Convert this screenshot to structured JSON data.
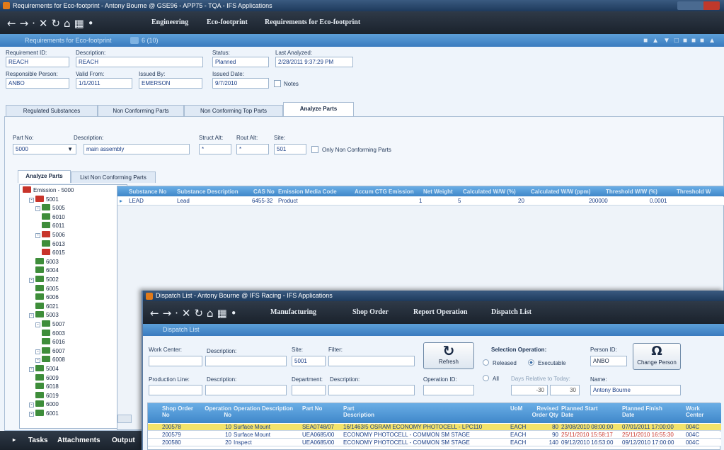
{
  "main": {
    "title": "Requirements for Eco-footprint - Antony Bourne @ GSE96 - APP75 - TQA - IFS Applications",
    "nav": {
      "crumb1": "Engineering",
      "crumb2": "Eco-footprint",
      "crumb3": "Requirements for Eco-footprint"
    },
    "band": {
      "title": "Requirements for Eco-footprint",
      "count": "6 (10)"
    },
    "form": {
      "req_id_label": "Requirement ID:",
      "req_id": "REACH",
      "desc_label": "Description:",
      "desc": "REACH",
      "status_label": "Status:",
      "status": "Planned",
      "last_label": "Last Analyzed:",
      "last": "2/28/2011 9:37:29 PM",
      "resp_label": "Responsible Person:",
      "resp": "ANBO",
      "valid_label": "Valid From:",
      "valid": "1/1/2011",
      "issuedby_label": "Issued By:",
      "issuedby": "EMERSON",
      "issued_date_label": "Issued Date:",
      "issued_date": "9/7/2010",
      "notes_label": "Notes"
    },
    "tabs": [
      "Regulated Substances",
      "Non Conforming Parts",
      "Non Conforming Top Parts",
      "Analyze Parts"
    ],
    "part": {
      "partno_label": "Part No:",
      "partno": "5000",
      "desc_label": "Description:",
      "desc": "main assembly",
      "struct_label": "Struct Alt:",
      "struct": "*",
      "rout_label": "Rout Alt:",
      "rout": "*",
      "site_label": "Site:",
      "site": "501",
      "only_label": "Only Non Conforming Parts"
    },
    "subtabs": [
      "Analyze Parts",
      "List Non Conforming Parts"
    ],
    "tree": [
      {
        "label": "Emission - 5000",
        "bad": true
      },
      {
        "label": "5001",
        "bad": true
      },
      {
        "label": "5005",
        "bad": false
      },
      {
        "label": "6010",
        "bad": false
      },
      {
        "label": "6011",
        "bad": false
      },
      {
        "label": "5006",
        "bad": true
      },
      {
        "label": "6013",
        "bad": false
      },
      {
        "label": "6015",
        "bad": true
      },
      {
        "label": "6003",
        "bad": false
      },
      {
        "label": "6004",
        "bad": false
      },
      {
        "label": "5002",
        "bad": false
      },
      {
        "label": "6005",
        "bad": false
      },
      {
        "label": "6006",
        "bad": false
      },
      {
        "label": "6021",
        "bad": false
      },
      {
        "label": "5003",
        "bad": false
      },
      {
        "label": "5007",
        "bad": false
      },
      {
        "label": "6003",
        "bad": false
      },
      {
        "label": "6016",
        "bad": false
      },
      {
        "label": "6007",
        "bad": false
      },
      {
        "label": "6008",
        "bad": false
      },
      {
        "label": "5004",
        "bad": false
      },
      {
        "label": "6009",
        "bad": false
      },
      {
        "label": "6018",
        "bad": false
      },
      {
        "label": "6019",
        "bad": false
      },
      {
        "label": "6000",
        "bad": false
      },
      {
        "label": "6001",
        "bad": false
      }
    ],
    "grid": {
      "headers": [
        "Substance No",
        "Substance Description",
        "CAS No",
        "Emission Media Code",
        "Accum CTG Emission",
        "Net Weight",
        "Calculated W/W (%)",
        "Calculated W/W (ppm)",
        "Threshold W/W (%)",
        "Threshold W"
      ],
      "row": [
        "LEAD",
        "Lead",
        "6455-32",
        "Product",
        "1",
        "5",
        "20",
        "200000",
        "0.0001",
        ""
      ]
    },
    "bottom": {
      "tasks": "Tasks",
      "attachments": "Attachments",
      "output": "Output"
    }
  },
  "dispatch": {
    "title": "Dispatch List - Antony Bourne @ IFS Racing - IFS Applications",
    "nav": {
      "crumb1": "Manufacturing",
      "crumb2": "Shop Order",
      "crumb3": "Report Operation",
      "crumb4": "Dispatch List"
    },
    "band": "Dispatch List",
    "form": {
      "wc_label": "Work Center:",
      "desc_label": "Description:",
      "site_label": "Site:",
      "site": "5001",
      "filter_label": "Filter:",
      "refresh": "Refresh",
      "selop_label": "Selection Operation:",
      "released": "Released",
      "executable": "Executable",
      "all": "All",
      "days_label": "Days Relative to Today:",
      "days_from": "-30",
      "days_to": "30",
      "person_label": "Person ID:",
      "person": "ANBO",
      "change_person": "Change Person",
      "name_label": "Name:",
      "name": "Antony Bourne",
      "pl_label": "Production Line:",
      "pl_desc_label": "Description:",
      "dept_label": "Department:",
      "dept_desc_label": "Description:",
      "opid_label": "Operation ID:"
    },
    "headers": [
      "Shop Order No",
      "Operation No",
      "Operation Description",
      "Part No",
      "Part Description",
      "UoM",
      "Revised Order Qty",
      "Planned Start Date",
      "Planned Finish Date",
      "Work Center"
    ],
    "rows": [
      [
        "200578",
        "10",
        "Surface Mount",
        "SEA0748/07",
        "16/1463/5 OSRAM ECONOMY PHOTOCELL - LPC110",
        "EACH",
        "80",
        "23/08/2010 08:00:00",
        "07/01/2011 17:00:00",
        "004C"
      ],
      [
        "200579",
        "10",
        "Surface Mount",
        "UEA0685/00",
        "ECONOMY PHOTOCELL - COMMON SM STAGE",
        "EACH",
        "90",
        "25/11/2010 15:58:17",
        "25/11/2010 16:55:30",
        "004C"
      ],
      [
        "200580",
        "20",
        "Inspect",
        "UEA0685/00",
        "ECONOMY PHOTOCELL - COMMON SM STAGE",
        "EACH",
        "140",
        "09/12/2010 16:53:00",
        "09/12/2010 17:00:00",
        "004C"
      ]
    ]
  },
  "colors": {
    "accent": "#3f87c9",
    "bad": "#c8342a",
    "ok": "#3e8d3a",
    "highlight_row": "#f3e36a"
  }
}
